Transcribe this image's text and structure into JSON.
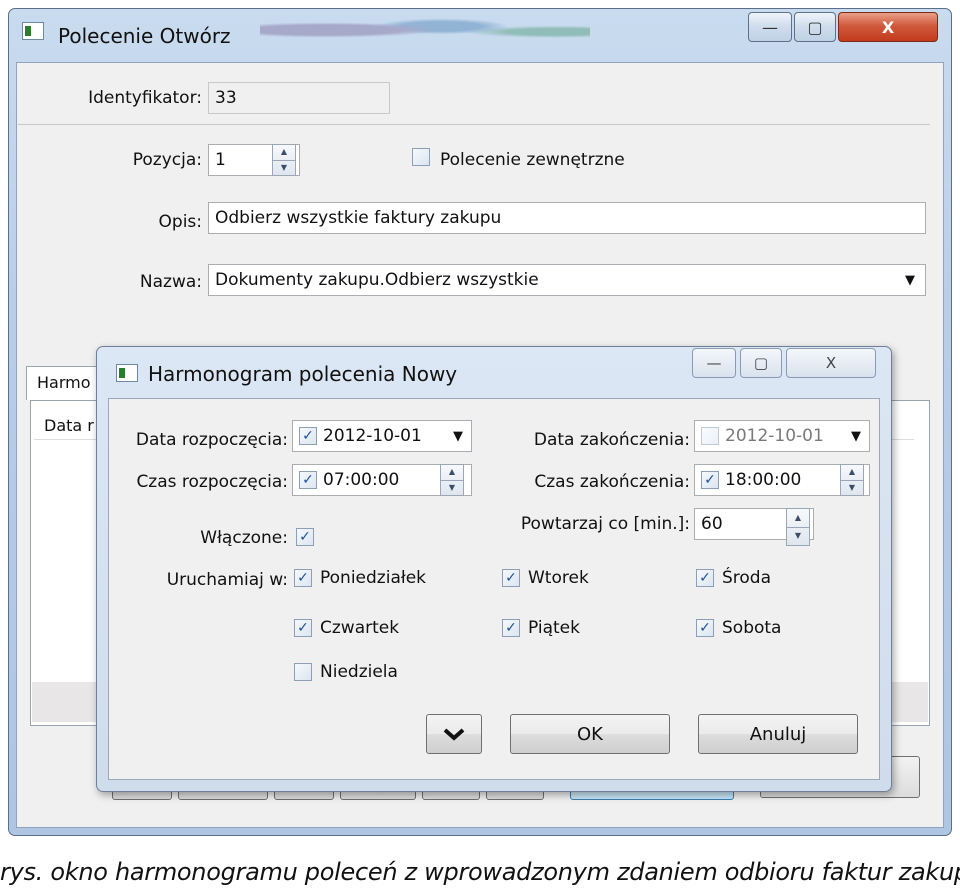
{
  "outer_window": {
    "title": "Polecenie Otwórz",
    "controls": {
      "minimize": "—",
      "maximize": "▢",
      "close": "X"
    },
    "identifier_label": "Identyfikator:",
    "identifier_value": "33",
    "position_label": "Pozycja:",
    "position_value": "1",
    "external_label": "Polecenie zewnętrzne",
    "description_label": "Opis:",
    "description_value": "Odbierz wszystkie faktury zakupu",
    "name_label": "Nazwa:",
    "name_value": "Dokumenty zakupu.Odbierz wszystkie",
    "tab_label": "Harmo",
    "column_header": "Data r"
  },
  "dialog": {
    "title": "Harmonogram polecenia Nowy",
    "controls": {
      "minimize": "—",
      "maximize": "▢",
      "close": "X"
    },
    "start_date_label": "Data rozpoczęcia:",
    "start_date_value": "2012-10-01",
    "start_date_checked": true,
    "end_date_label": "Data zakończenia:",
    "end_date_value": "2012-10-01",
    "end_date_checked": false,
    "start_time_label": "Czas rozpoczęcia:",
    "start_time_value": "07:00:00",
    "start_time_checked": true,
    "end_time_label": "Czas zakończenia:",
    "end_time_value": "18:00:00",
    "end_time_checked": true,
    "enabled_label": "Włączone:",
    "enabled_checked": true,
    "repeat_label": "Powtarzaj co [min.]:",
    "repeat_value": "60",
    "run_on_label": "Uruchamiaj w:",
    "days": [
      {
        "label": "Poniedziałek",
        "checked": true
      },
      {
        "label": "Wtorek",
        "checked": true
      },
      {
        "label": "Środa",
        "checked": true
      },
      {
        "label": "Czwartek",
        "checked": true
      },
      {
        "label": "Piątek",
        "checked": true
      },
      {
        "label": "Sobota",
        "checked": true
      },
      {
        "label": "Niedziela",
        "checked": false
      }
    ],
    "expand_icon": "chevron-down",
    "ok_label": "OK",
    "cancel_label": "Anuluj"
  },
  "caption": "rys. okno harmonogramu poleceń z wprowadzonym zdaniem odbioru faktur zakupu"
}
